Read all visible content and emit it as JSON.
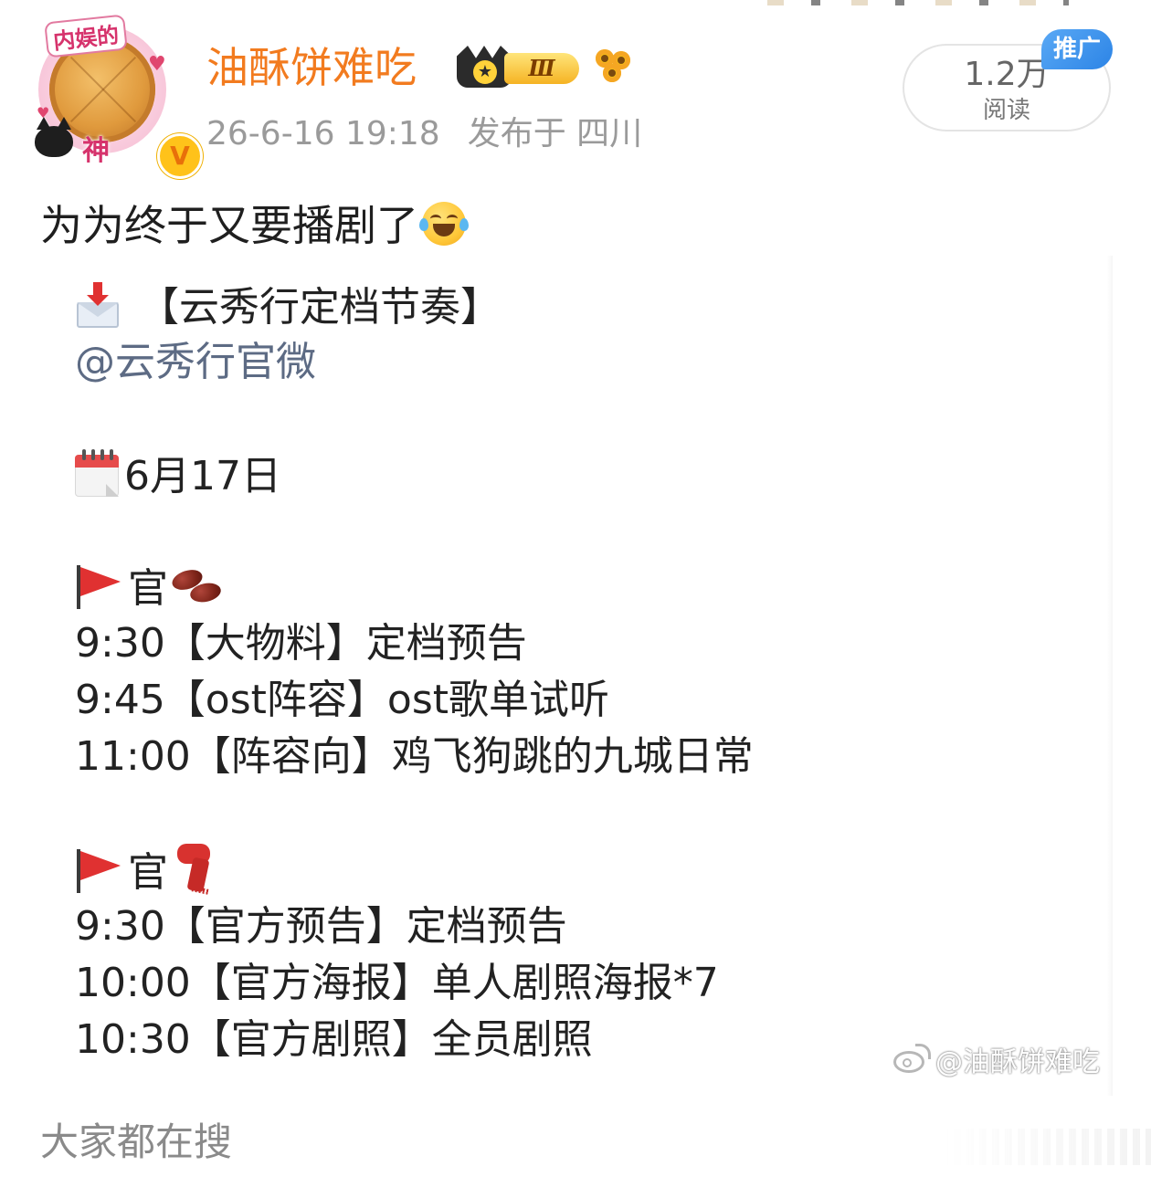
{
  "header": {
    "avatar": {
      "top_label": "内娱的",
      "bottom_label": "神",
      "verified_mark": "V",
      "icon": "pie-avatar-icon"
    },
    "username": "油酥饼难吃",
    "badges": {
      "crown_level": "Ⅲ",
      "crown_icon": "crown-icon",
      "flower_icon": "sunflower-icon"
    },
    "timestamp": "26-6-16 19:18",
    "location": "发布于 四川",
    "read_count": "1.2万",
    "read_label": "阅读",
    "promo_label": "推广",
    "colors": {
      "username": "#f27b1f",
      "promo_badge": "#2c84e6",
      "meta_text": "#9a9a9a"
    }
  },
  "post": {
    "text": "为为终于又要播剧了",
    "emoji": "laughing-tears-emoji"
  },
  "image_card": {
    "heading": "【云秀行定档节奏】",
    "mention": "@云秀行官微",
    "date": "6月17日",
    "groups": [
      {
        "label": "官",
        "emoji": "beans-emoji",
        "items": [
          "9:30【大物料】定档预告",
          "9:45【ost阵容】ost歌单试听",
          "11:00【阵容向】鸡飞狗跳的九城日常"
        ]
      },
      {
        "label": "官",
        "emoji": "scarf-emoji",
        "items": [
          "9:30【官方预告】定档预告",
          "10:00【官方海报】单人剧照海报*7",
          "10:30【官方剧照】全员剧照"
        ]
      }
    ],
    "watermark": "@油酥饼难吃"
  },
  "footer": {
    "section_title": "大家都在搜"
  }
}
